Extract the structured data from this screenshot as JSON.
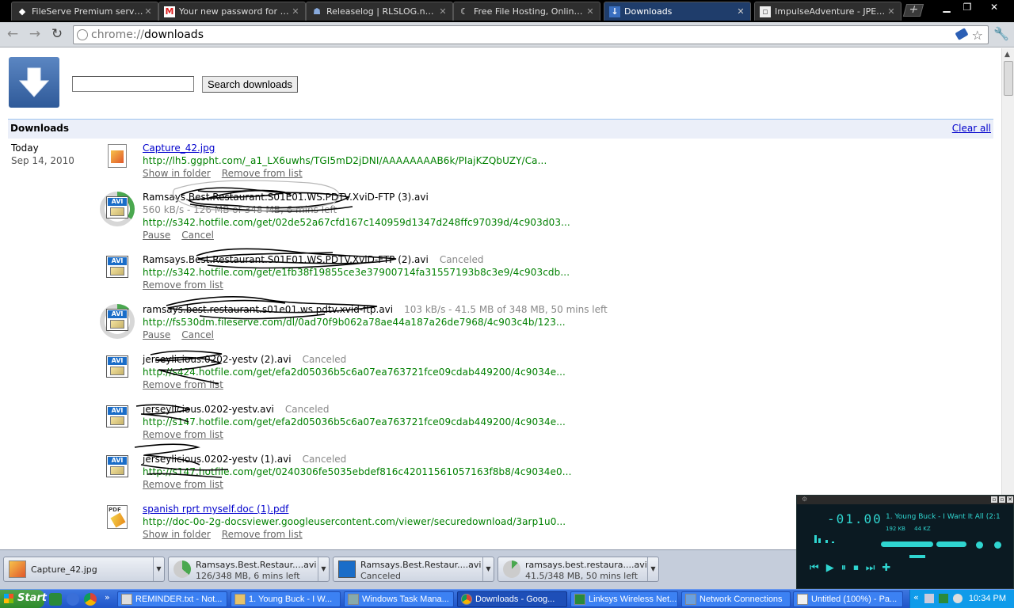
{
  "tabs": [
    {
      "label": "FileServe Premium service...",
      "icon": "fileserve-icon",
      "active": false
    },
    {
      "label": "Your new password for Di...",
      "icon": "gmail-icon",
      "active": false
    },
    {
      "label": "Releaselog | RLSLOG.net ...",
      "icon": "rlslog-icon",
      "active": false
    },
    {
      "label": "Free File Hosting, Online ...",
      "icon": "moon-icon",
      "active": false
    },
    {
      "label": "Downloads",
      "icon": "download-icon",
      "active": true
    },
    {
      "label": "ImpulseAdventure - JPEG...",
      "icon": "page-icon",
      "active": false
    }
  ],
  "omnibox": {
    "prefix": "chrome://",
    "path": "downloads"
  },
  "page": {
    "search_button": "Search downloads",
    "section_title": "Downloads",
    "clear_all": "Clear all",
    "date_label": "Today",
    "date_full": "Sep 14, 2010"
  },
  "downloads": [
    {
      "name": "Capture_42.jpg",
      "link": true,
      "status": "",
      "progress": "",
      "url": "http://lh5.ggpht.com/_a1_LX6uwhs/TGI5mD2jDNI/AAAAAAAAB6k/PIajKZQbUZY/Ca...",
      "actions": [
        "Show in folder",
        "Remove from list"
      ],
      "icon": "image-file-icon"
    },
    {
      "name": "Ramsays.Best.Restaurant.S01E01.WS.PDTV.XviD-FTP (3).avi",
      "link": false,
      "status": "",
      "progress": "560 kB/s - 126 MB of 348 MB, 6 mins left",
      "progress_fraction": 0.36,
      "url": "http://s342.hotfile.com/get/02de52a67cfd167c140959d1347d248ffc97039d/4c903d03...",
      "actions": [
        "Pause",
        "Cancel"
      ],
      "icon": "avi-file-icon"
    },
    {
      "name": "Ramsays.Best.Restaurant.S01E01.WS.PDTV.XviD-FTP (2).avi",
      "link": false,
      "status": "Canceled",
      "progress": "",
      "url": "http://s342.hotfile.com/get/e1fb38f19855ce3e37900714fa31557193b8c3e9/4c903cdb...",
      "actions": [
        "Remove from list"
      ],
      "icon": "avi-file-icon"
    },
    {
      "name": "ramsays.best.restaurant.s01e01.ws.pdtv.xvid-ftp.avi",
      "link": false,
      "status": "103 kB/s - 41.5 MB of 348 MB, 50 mins left",
      "progress": "",
      "progress_fraction": 0.12,
      "url": "http://fs530dm.fileserve.com/dl/0ad70f9b062a78ae44a187a26de7968/4c903c4b/123...",
      "actions": [
        "Pause",
        "Cancel"
      ],
      "icon": "avi-file-icon"
    },
    {
      "name": "jerseylicious.0202-yestv (2).avi",
      "link": false,
      "status": "Canceled",
      "progress": "",
      "url": "http://s424.hotfile.com/get/efa2d05036b5c6a07ea763721fce09cdab449200/4c9034e...",
      "actions": [
        "Remove from list"
      ],
      "icon": "avi-file-icon"
    },
    {
      "name": "jerseylicious.0202-yestv.avi",
      "link": false,
      "status": "Canceled",
      "progress": "",
      "url": "http://s147.hotfile.com/get/efa2d05036b5c6a07ea763721fce09cdab449200/4c9034e...",
      "actions": [
        "Remove from list"
      ],
      "icon": "avi-file-icon"
    },
    {
      "name": "jerseylicious.0202-yestv (1).avi",
      "link": false,
      "status": "Canceled",
      "progress": "",
      "url": "http://s147.hotfile.com/get/0240306fe5035ebdef816c42011561057163f8b8/4c9034e0...",
      "actions": [
        "Remove from list"
      ],
      "icon": "avi-file-icon"
    },
    {
      "name": "spanish rprt myself.doc (1).pdf",
      "link": true,
      "status": "",
      "progress": "",
      "url": "http://doc-0o-2g-docsviewer.googleusercontent.com/viewer/securedownload/3arp1u0...",
      "actions": [
        "Show in folder",
        "Remove from list"
      ],
      "icon": "pdf-file-icon"
    }
  ],
  "shelf": [
    {
      "name": "Capture_42.jpg",
      "progress": ""
    },
    {
      "name": "Ramsays.Best.Restaur....avi",
      "progress": "126/348 MB, 6 mins left"
    },
    {
      "name": "Ramsays.Best.Restaur....avi",
      "progress": "Canceled"
    },
    {
      "name": "ramsays.best.restaura....avi",
      "progress": "41.5/348 MB, 50 mins left"
    }
  ],
  "player": {
    "time": "-01.00",
    "song": "1. Young Buck - I Want It All (2:1",
    "bitrate": "192 KB",
    "khz": "44 KZ"
  },
  "taskbar": {
    "start": "Start",
    "tasks": [
      {
        "label": "REMINDER.txt - Not...",
        "active": false
      },
      {
        "label": "1. Young Buck - I W...",
        "active": false
      },
      {
        "label": "Windows Task Mana...",
        "active": false
      },
      {
        "label": "Downloads - Goog...",
        "active": true
      },
      {
        "label": "Linksys Wireless Net...",
        "active": false
      },
      {
        "label": "Network Connections",
        "active": false
      },
      {
        "label": "Untitled (100%) - Pa...",
        "active": false
      }
    ],
    "clock": "10:34 PM"
  }
}
